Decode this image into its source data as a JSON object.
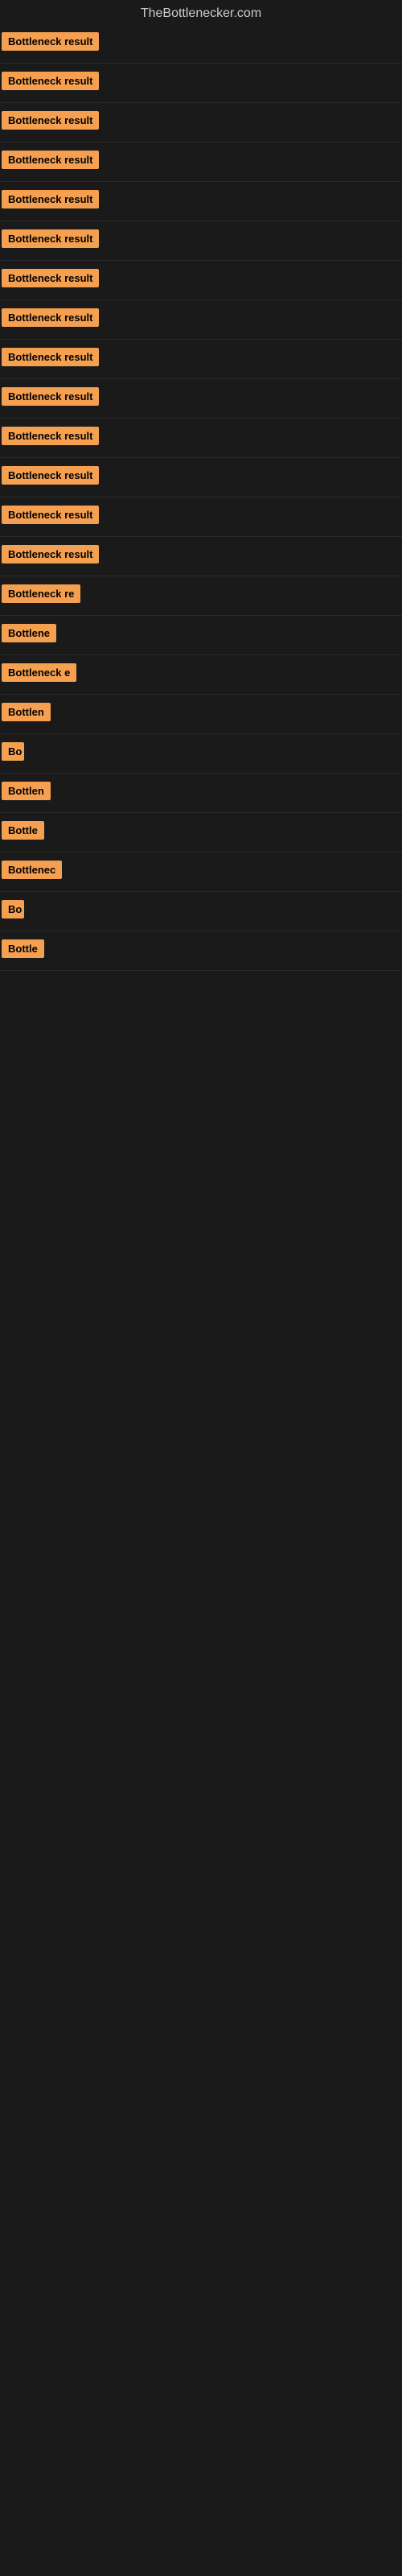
{
  "site": {
    "title": "TheBottlenecker.com"
  },
  "results": [
    {
      "id": 1,
      "label": "Bottleneck result",
      "width": 175
    },
    {
      "id": 2,
      "label": "Bottleneck result",
      "width": 175
    },
    {
      "id": 3,
      "label": "Bottleneck result",
      "width": 175
    },
    {
      "id": 4,
      "label": "Bottleneck result",
      "width": 175
    },
    {
      "id": 5,
      "label": "Bottleneck result",
      "width": 175
    },
    {
      "id": 6,
      "label": "Bottleneck result",
      "width": 175
    },
    {
      "id": 7,
      "label": "Bottleneck result",
      "width": 175
    },
    {
      "id": 8,
      "label": "Bottleneck result",
      "width": 175
    },
    {
      "id": 9,
      "label": "Bottleneck result",
      "width": 175
    },
    {
      "id": 10,
      "label": "Bottleneck result",
      "width": 175
    },
    {
      "id": 11,
      "label": "Bottleneck result",
      "width": 175
    },
    {
      "id": 12,
      "label": "Bottleneck result",
      "width": 175
    },
    {
      "id": 13,
      "label": "Bottleneck result",
      "width": 175
    },
    {
      "id": 14,
      "label": "Bottleneck result",
      "width": 175
    },
    {
      "id": 15,
      "label": "Bottleneck re",
      "width": 110
    },
    {
      "id": 16,
      "label": "Bottlene",
      "width": 80
    },
    {
      "id": 17,
      "label": "Bottleneck e",
      "width": 95
    },
    {
      "id": 18,
      "label": "Bottlen",
      "width": 70
    },
    {
      "id": 19,
      "label": "Bo",
      "width": 28
    },
    {
      "id": 20,
      "label": "Bottlen",
      "width": 70
    },
    {
      "id": 21,
      "label": "Bottle",
      "width": 58
    },
    {
      "id": 22,
      "label": "Bottlenec",
      "width": 88
    },
    {
      "id": 23,
      "label": "Bo",
      "width": 28
    },
    {
      "id": 24,
      "label": "Bottle",
      "width": 58
    }
  ]
}
